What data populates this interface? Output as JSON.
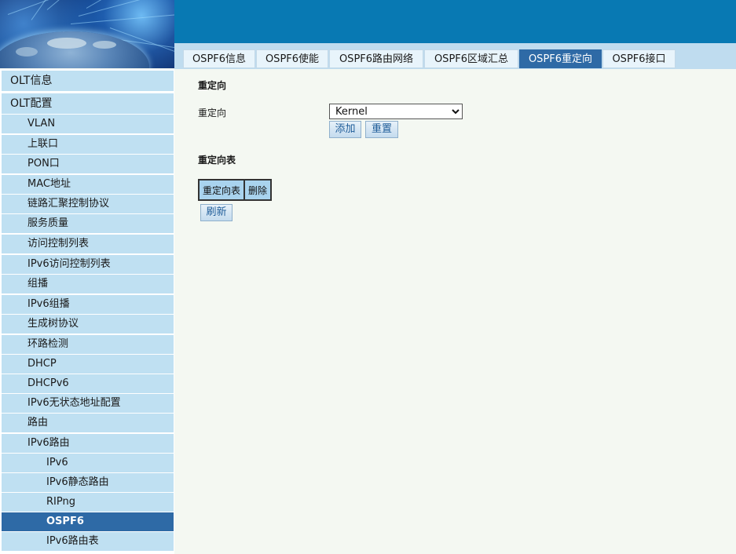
{
  "tabs": [
    {
      "label": "OSPF6信息"
    },
    {
      "label": "OSPF6使能"
    },
    {
      "label": "OSPF6路由网络"
    },
    {
      "label": "OSPF6区域汇总"
    },
    {
      "label": "OSPF6重定向",
      "active": true
    },
    {
      "label": "OSPF6接口"
    }
  ],
  "sidebar": {
    "items": [
      {
        "label": "OLT信息",
        "level": 1
      },
      {
        "label": "OLT配置",
        "level": 1
      },
      {
        "label": "VLAN",
        "level": 2
      },
      {
        "label": "上联口",
        "level": 2
      },
      {
        "label": "PON口",
        "level": 2
      },
      {
        "label": "MAC地址",
        "level": 2
      },
      {
        "label": "链路汇聚控制协议",
        "level": 2
      },
      {
        "label": "服务质量",
        "level": 2
      },
      {
        "label": "访问控制列表",
        "level": 2
      },
      {
        "label": "IPv6访问控制列表",
        "level": 2
      },
      {
        "label": "组播",
        "level": 2
      },
      {
        "label": "IPv6组播",
        "level": 2
      },
      {
        "label": "生成树协议",
        "level": 2
      },
      {
        "label": "环路检测",
        "level": 2
      },
      {
        "label": "DHCP",
        "level": 2
      },
      {
        "label": "DHCPv6",
        "level": 2
      },
      {
        "label": "IPv6无状态地址配置",
        "level": 2
      },
      {
        "label": "路由",
        "level": 2
      },
      {
        "label": "IPv6路由",
        "level": 2
      },
      {
        "label": "IPv6",
        "level": 3
      },
      {
        "label": "IPv6静态路由",
        "level": 3
      },
      {
        "label": "RIPng",
        "level": 3
      },
      {
        "label": "OSPF6",
        "level": 3,
        "active": true
      },
      {
        "label": "IPv6路由表",
        "level": 3
      }
    ]
  },
  "main": {
    "section_title": "重定向",
    "redirect_label": "重定向",
    "redirect_select": {
      "selected": "Kernel"
    },
    "add_button": "添加",
    "reset_button": "重置",
    "table_title": "重定向表",
    "table_columns": [
      "重定向表",
      "删除"
    ],
    "refresh_button": "刷新"
  },
  "colors": {
    "banner": "#0879b3",
    "active_tab": "#2e6aa6",
    "nav_item": "#bfe0f2",
    "table_header": "#a9d3ee"
  }
}
